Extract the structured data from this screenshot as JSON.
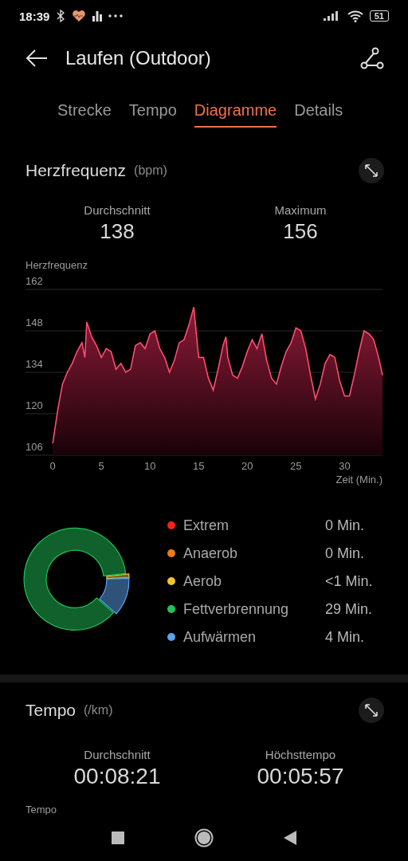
{
  "status_bar": {
    "time": "18:39",
    "battery": "51"
  },
  "header": {
    "title": "Laufen (Outdoor)"
  },
  "tabs": [
    {
      "label": "Strecke",
      "selected": false
    },
    {
      "label": "Tempo",
      "selected": false
    },
    {
      "label": "Diagramme",
      "selected": true
    },
    {
      "label": "Details",
      "selected": false
    }
  ],
  "heart_rate": {
    "title": "Herzfrequenz",
    "unit": "(bpm)",
    "stats": [
      {
        "label": "Durchschnitt",
        "value": "138"
      },
      {
        "label": "Maximum",
        "value": "156"
      }
    ],
    "chart_data": {
      "type": "area",
      "xlabel": "Zeit (Min.)",
      "grid": true,
      "xlim": [
        -2.8,
        33.9
      ],
      "ylim": [
        106,
        162
      ],
      "xticks": [
        0,
        5,
        10,
        15,
        20,
        25,
        30
      ],
      "yticks": [
        106,
        120,
        134,
        148,
        162
      ],
      "x": [
        0,
        0.5,
        1,
        1.5,
        2,
        2.5,
        3,
        3.3,
        3.5,
        4,
        4.5,
        5,
        5.5,
        6,
        6.5,
        7,
        7.5,
        8,
        8.5,
        9,
        9.5,
        10,
        10.5,
        11,
        11.5,
        12,
        12.5,
        13,
        13.5,
        14,
        14.5,
        15,
        15.5,
        16,
        16.5,
        17,
        17.5,
        17.8,
        18,
        18.5,
        19,
        19.5,
        20,
        20.5,
        21,
        21.5,
        22,
        22.5,
        23,
        23.5,
        24,
        24.5,
        25,
        25.5,
        26,
        26.5,
        27,
        27.5,
        28,
        28.5,
        29,
        29.5,
        30,
        30.5,
        31,
        31.5,
        32,
        32.5,
        33,
        33.5,
        33.9
      ],
      "series": [
        {
          "name": "Herzfrequenz",
          "color": "#ff4d6d",
          "values": [
            110,
            121,
            130,
            134,
            137,
            141,
            144,
            139,
            151,
            146,
            143,
            139,
            142,
            141,
            135,
            137,
            134,
            135,
            143,
            144,
            142,
            147,
            148,
            142,
            139,
            134,
            138,
            144,
            145,
            150,
            156,
            139,
            139,
            132,
            128,
            135,
            143,
            146,
            139,
            133,
            132,
            136,
            141,
            145,
            142,
            147,
            138,
            132,
            130,
            136,
            141,
            144,
            149,
            148,
            142,
            133,
            125,
            130,
            137,
            140,
            139,
            131,
            126,
            126,
            133,
            141,
            148,
            147,
            145,
            139,
            133
          ]
        }
      ]
    }
  },
  "zones": {
    "chart_data": {
      "type": "donut",
      "categories": [
        "Extrem",
        "Anaerob",
        "Aerob",
        "Fettverbrennung",
        "Aufwärmen"
      ],
      "series": [
        {
          "values": [
            0,
            0,
            1.2,
            86.8,
            12
          ]
        }
      ]
    },
    "legend": [
      {
        "value": "0 Min.",
        "color": "#f5221b"
      },
      {
        "value": "0 Min.",
        "color": "#ef7a1a"
      },
      {
        "value": "<1 Min.",
        "color": "#f5c42c"
      },
      {
        "value": "29 Min.",
        "color": "#20c256"
      },
      {
        "value": "4 Min.",
        "color": "#5ba3f0"
      }
    ]
  },
  "tempo": {
    "title": "Tempo",
    "unit": "(/km)",
    "stats": [
      {
        "label": "Durchschnitt",
        "value": "00:08:21"
      },
      {
        "label": "Höchsttempo",
        "value": "00:05:57"
      }
    ],
    "chart_label": "Tempo"
  }
}
